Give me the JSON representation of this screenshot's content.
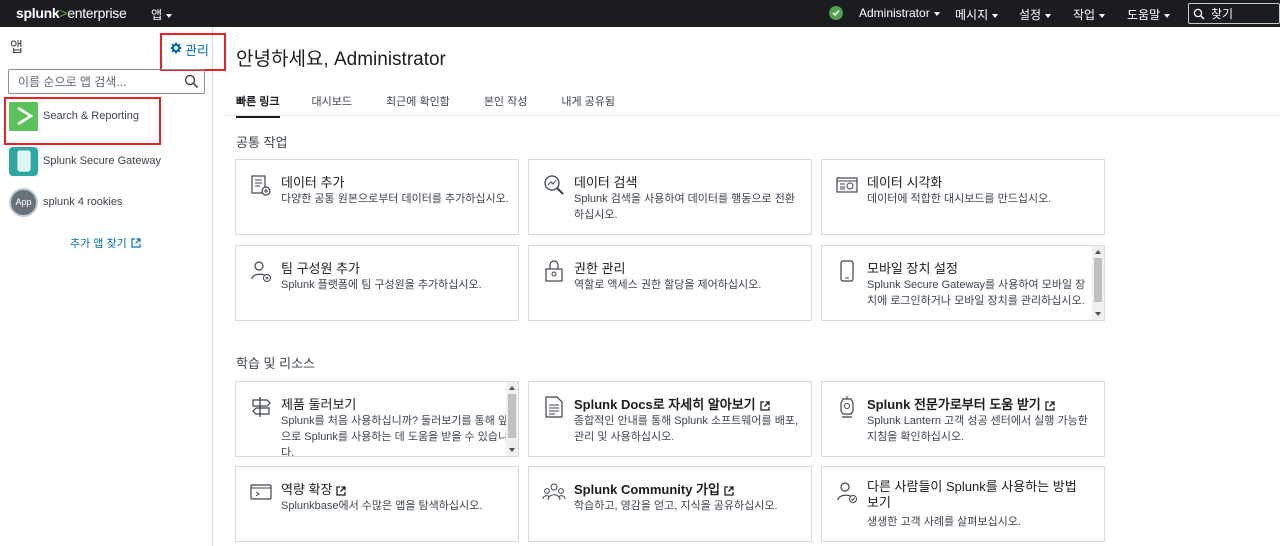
{
  "topbar": {
    "logo_brand": "splunk",
    "logo_gt": ">",
    "logo_product": "enterprise",
    "apps_menu": "앱",
    "user_menu": "Administrator",
    "messages_menu": "메시지",
    "settings_menu": "설정",
    "activity_menu": "작업",
    "help_menu": "도움말",
    "search_placeholder": "찾기"
  },
  "sidebar": {
    "title": "앱",
    "manage_label": "관리",
    "search_placeholder": "이름 순으로 앱 검색...",
    "apps": [
      {
        "label": "Search & Reporting"
      },
      {
        "label": "Splunk Secure Gateway"
      },
      {
        "label": "splunk 4 rookies",
        "icon_text": "App"
      }
    ],
    "more_apps": "추가 앱 찾기"
  },
  "main": {
    "greeting": "안녕하세요, Administrator",
    "tabs": [
      "빠른 링크",
      "대시보드",
      "최근에 확인함",
      "본인 작성",
      "내게 공유됨"
    ],
    "common_tasks_title": "공통 작업",
    "common_tasks": [
      {
        "title": "데이터 추가",
        "desc": "다양한 공통 원본으로부터 데이터를 추가하십시오.",
        "icon": "add-data-icon"
      },
      {
        "title": "데이터 검색",
        "desc": "Splunk 검색을 사용하여 데이터를 행동으로 전환하십시오.",
        "icon": "search-data-icon"
      },
      {
        "title": "데이터 시각화",
        "desc": "데이터에 적합한 대시보드를 만드십시오.",
        "icon": "visualize-icon"
      },
      {
        "title": "팀 구성원 추가",
        "desc": "Splunk 플랫폼에 팀 구성원을 추가하십시오.",
        "icon": "add-user-icon"
      },
      {
        "title": "권한 관리",
        "desc": "역할로 액세스 권한 할당을 제어하십시오.",
        "icon": "lock-icon"
      },
      {
        "title": "모바일 장치 설정",
        "desc": "Splunk Secure Gateway를 사용하여 모바일 장치에 로그인하거나 모바일 장치를 관리하십시오.",
        "icon": "mobile-icon"
      }
    ],
    "learning_title": "학습 및 리소스",
    "learning": [
      {
        "title": "제품 둘러보기",
        "desc": "Splunk를 처음 사용하십니까? 둘러보기를 통해 앞으로 Splunk를 사용하는 데 도움을 받을 수 있습니다.",
        "icon": "signpost-icon"
      },
      {
        "title": "Splunk Docs로 자세히 알아보기",
        "desc": "종합적인 안내를 통해 Splunk 소프트웨어를 배포, 관리 및 사용하십시오.",
        "icon": "document-icon"
      },
      {
        "title": "Splunk 전문가로부터 도움 받기",
        "desc": "Splunk Lantern 고객 성공 센터에서 실행 가능한 지침을 확인하십시오.",
        "icon": "lantern-icon"
      },
      {
        "title": "역량 확장",
        "desc": "Splunkbase에서 수많은 앱을 탐색하십시오.",
        "icon": "splunkbase-icon"
      },
      {
        "title": "Splunk Community 가입",
        "desc": "학습하고, 영감을 얻고, 지식을 공유하십시오.",
        "icon": "community-icon"
      },
      {
        "title": "다른 사람들이 Splunk를 사용하는 방법 보기",
        "desc": "생생한 고객 사례를 살펴보십시오.",
        "icon": "customer-icon"
      }
    ]
  }
}
